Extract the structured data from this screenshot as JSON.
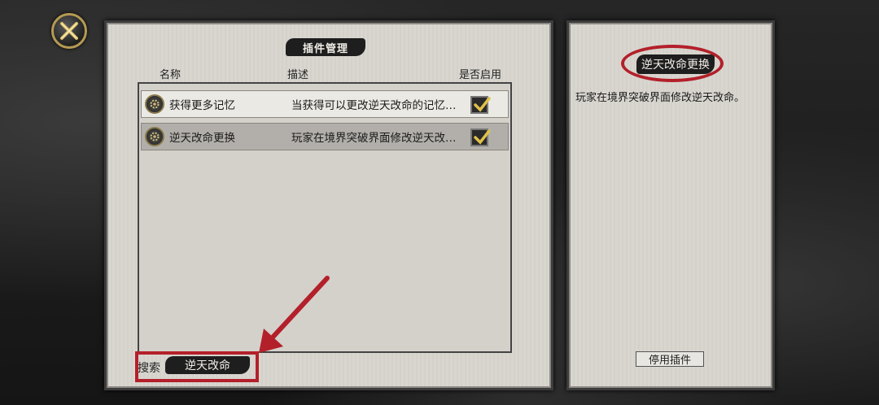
{
  "plugin_panel": {
    "title": "插件管理",
    "columns": {
      "name": "名称",
      "description": "描述",
      "enabled": "是否启用"
    },
    "plugins": [
      {
        "name": "获得更多记忆",
        "description": "当获得可以更改逆天改命的记忆…",
        "enabled": true
      },
      {
        "name": "逆天改命更换",
        "description": "玩家在境界突破界面修改逆天改…",
        "enabled": true
      }
    ],
    "search": {
      "label": "搜索",
      "value": "逆天改命"
    }
  },
  "detail_panel": {
    "title": "逆天改命更换",
    "description": "玩家在境界突破界面修改逆天改命。",
    "disable_button": "停用插件"
  },
  "colors": {
    "annotation_red": "#b3202a",
    "panel_paper": "#d9d6d0",
    "ink": "#1e1e1e"
  }
}
